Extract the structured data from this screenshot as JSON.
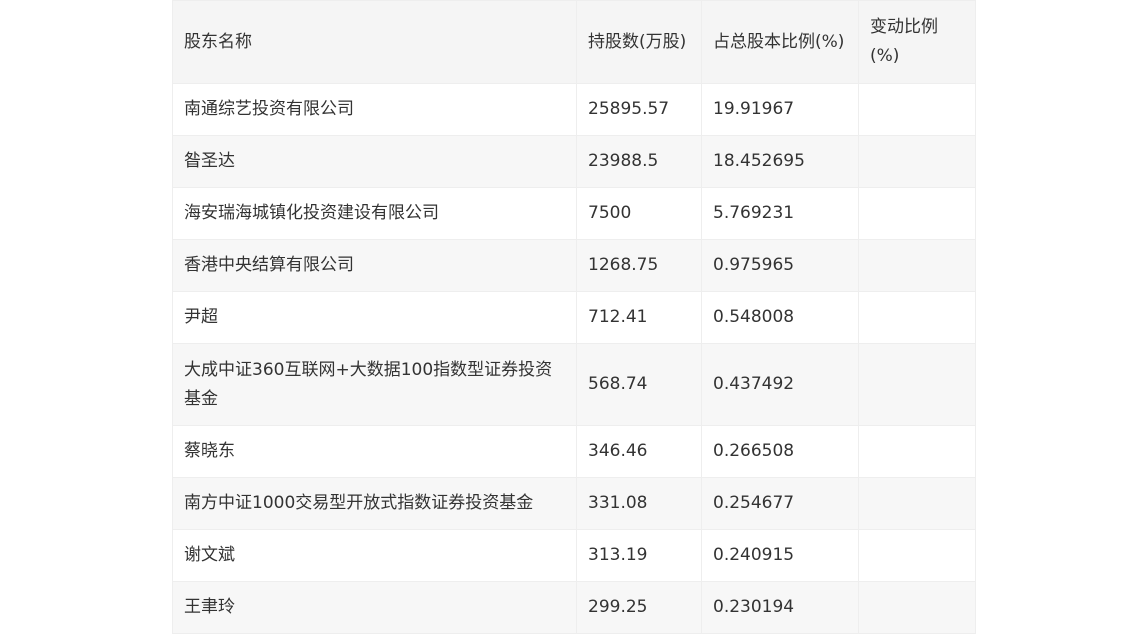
{
  "table": {
    "headers": [
      "股东名称",
      "持股数(万股)",
      "占总股本比例(%)",
      "变动比例(%)"
    ],
    "rows": [
      {
        "name": "南通综艺投资有限公司",
        "shares": "25895.57",
        "ratio": "19.91967",
        "change": ""
      },
      {
        "name": "昝圣达",
        "shares": "23988.5",
        "ratio": "18.452695",
        "change": ""
      },
      {
        "name": "海安瑞海城镇化投资建设有限公司",
        "shares": "7500",
        "ratio": "5.769231",
        "change": ""
      },
      {
        "name": "香港中央结算有限公司",
        "shares": "1268.75",
        "ratio": "0.975965",
        "change": ""
      },
      {
        "name": "尹超",
        "shares": "712.41",
        "ratio": "0.548008",
        "change": ""
      },
      {
        "name": "大成中证360互联网+大数据100指数型证券投资基金",
        "shares": "568.74",
        "ratio": "0.437492",
        "change": ""
      },
      {
        "name": "蔡晓东",
        "shares": "346.46",
        "ratio": "0.266508",
        "change": ""
      },
      {
        "name": "南方中证1000交易型开放式指数证券投资基金",
        "shares": "331.08",
        "ratio": "0.254677",
        "change": ""
      },
      {
        "name": "谢文斌",
        "shares": "313.19",
        "ratio": "0.240915",
        "change": ""
      },
      {
        "name": "王聿玲",
        "shares": "299.25",
        "ratio": "0.230194",
        "change": ""
      }
    ]
  }
}
